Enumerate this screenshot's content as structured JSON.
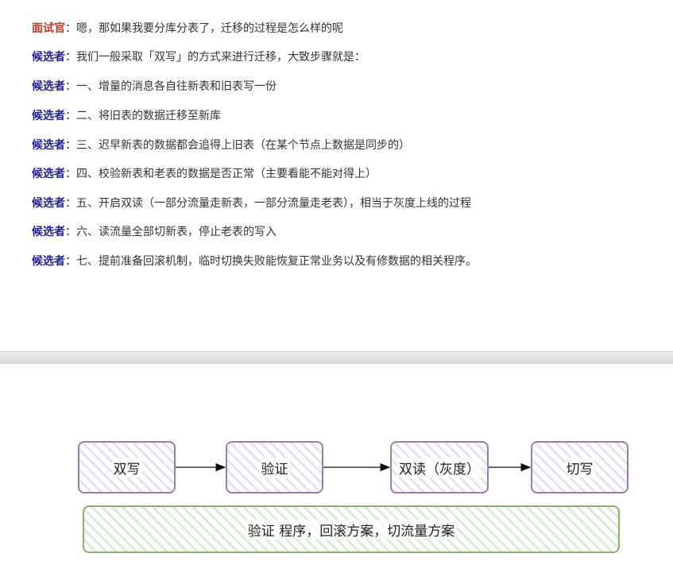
{
  "dialogue": [
    {
      "role": "面试官",
      "kind": "interviewer",
      "text": "嗯，那如果我要分库分表了，迁移的过程是怎么样的呢"
    },
    {
      "role": "候选者",
      "kind": "candidate",
      "text": "我们一般采取「双写」的方式来进行迁移，大致步骤就是："
    },
    {
      "role": "候选者",
      "kind": "candidate",
      "text": "一、增量的消息各自往新表和旧表写一份"
    },
    {
      "role": "候选者",
      "kind": "candidate",
      "text": "二、将旧表的数据迁移至新库"
    },
    {
      "role": "候选者",
      "kind": "candidate",
      "text": "三、迟早新表的数据都会追得上旧表（在某个节点上数据是同步的）"
    },
    {
      "role": "候选者",
      "kind": "candidate",
      "text": "四、校验新表和老表的数据是否正常（主要看能不能对得上）"
    },
    {
      "role": "候选者",
      "kind": "candidate",
      "text": "五、开启双读（一部分流量走新表，一部分流量走老表），相当于灰度上线的过程"
    },
    {
      "role": "候选者",
      "kind": "candidate",
      "text": "六、读流量全部切新表，停止老表的写入"
    },
    {
      "role": "候选者",
      "kind": "candidate",
      "text": "七、提前准备回滚机制，临时切换失败能恢复正常业务以及有修数据的相关程序。"
    }
  ],
  "colon": "：",
  "diagram": {
    "steps": [
      "双写",
      "验证",
      "双读（灰度）",
      "切写"
    ],
    "plan_label": "验证 程序，回滚方案，切流量方案"
  },
  "colors": {
    "interviewer": "#c0392b",
    "candidate": "#1f1f8f",
    "step_border": "#9b7cb0",
    "plan_border": "#82b366"
  }
}
